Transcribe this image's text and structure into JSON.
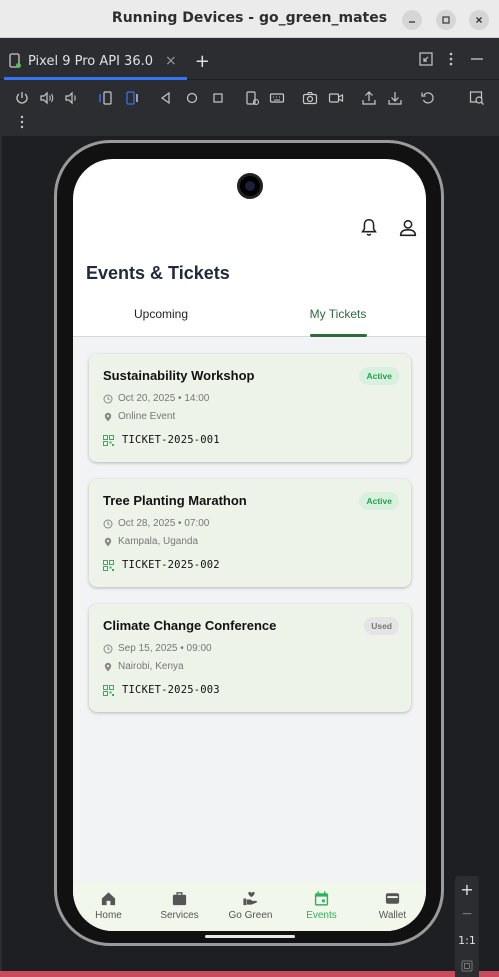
{
  "window": {
    "title": "Running Devices - go_green_mates"
  },
  "device_tab": {
    "label": "Pixel 9 Pro API 36.0",
    "close_glyph": "×",
    "add_glyph": "+"
  },
  "zoom": {
    "plus": "+",
    "minus": "−",
    "actual_size": "1:1"
  },
  "app": {
    "page_title": "Events & Tickets",
    "tabs": [
      {
        "label": "Upcoming"
      },
      {
        "label": "My Tickets",
        "selected": true
      }
    ],
    "accent_color": "#2e6b3a",
    "tickets": [
      {
        "title": "Sustainability Workshop",
        "status": "Active",
        "datetime": "Oct 20, 2025 • 14:00",
        "location": "Online Event",
        "ticket_id": "TICKET-2025-001"
      },
      {
        "title": "Tree Planting Marathon",
        "status": "Active",
        "datetime": "Oct 28, 2025 • 07:00",
        "location": "Kampala, Uganda",
        "ticket_id": "TICKET-2025-002"
      },
      {
        "title": "Climate Change Conference",
        "status": "Used",
        "datetime": "Sep 15, 2025 • 09:00",
        "location": "Nairobi, Kenya",
        "ticket_id": "TICKET-2025-003"
      }
    ],
    "nav": [
      {
        "label": "Home",
        "icon": "home-icon"
      },
      {
        "label": "Services",
        "icon": "briefcase-icon"
      },
      {
        "label": "Go Green",
        "icon": "hand-heart-icon"
      },
      {
        "label": "Events",
        "icon": "calendar-icon",
        "active": true
      },
      {
        "label": "Wallet",
        "icon": "wallet-icon"
      }
    ],
    "nav_active_color": "#2fb25c"
  }
}
